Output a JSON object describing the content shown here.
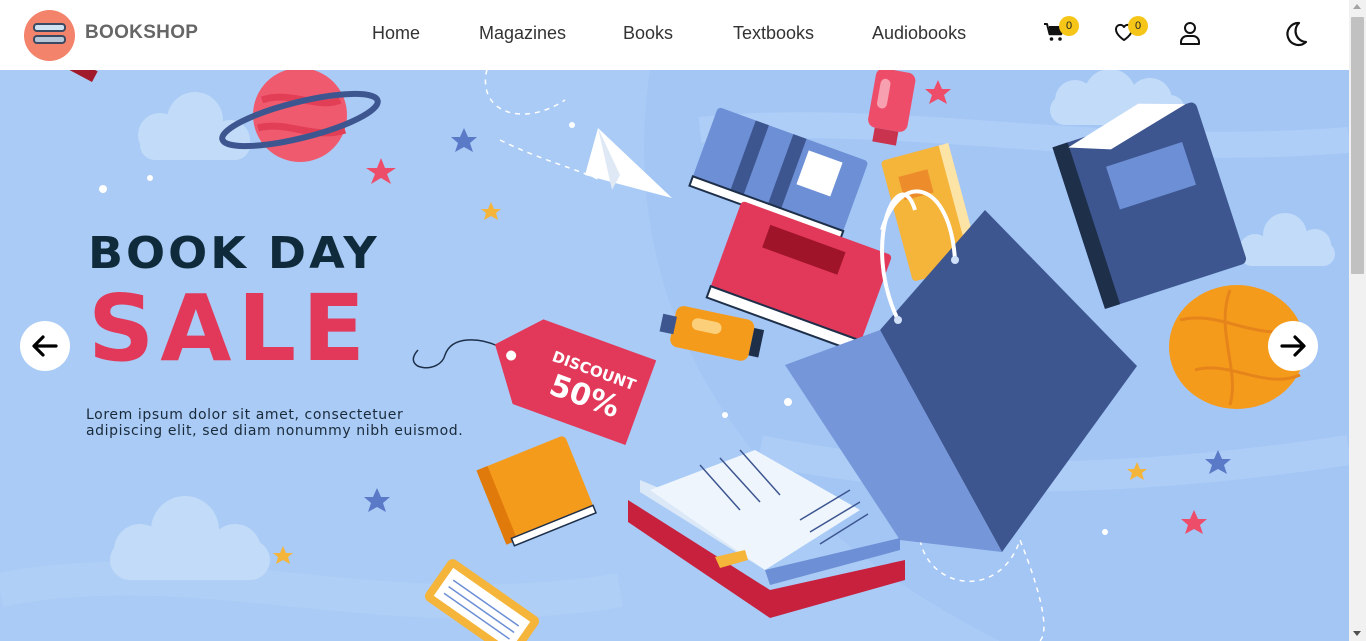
{
  "header": {
    "brand": "BOOKSHOP",
    "nav": [
      "Home",
      "Magazines",
      "Books",
      "Textbooks",
      "Audiobooks"
    ],
    "cart_count": "0",
    "wishlist_count": "0",
    "icons": [
      "cart-icon",
      "heart-icon",
      "user-icon",
      "moon-icon"
    ]
  },
  "hero": {
    "title_line1": "BOOK DAY",
    "title_line2": "SALE",
    "tag_line1": "DISCOUNT",
    "tag_line2": "50%",
    "description": "Lorem ipsum dolor sit amet, consectetuer adipiscing elit, sed diam nonummy nibh euismod.",
    "prev_icon": "arrow-left-icon",
    "next_icon": "arrow-right-icon"
  },
  "colors": {
    "hero_bg": "#a9cbf5",
    "title_dark": "#0f2a3a",
    "sale_red": "#e2385a",
    "badge_yellow": "#f5c518",
    "logo_orange": "#f3836a"
  }
}
